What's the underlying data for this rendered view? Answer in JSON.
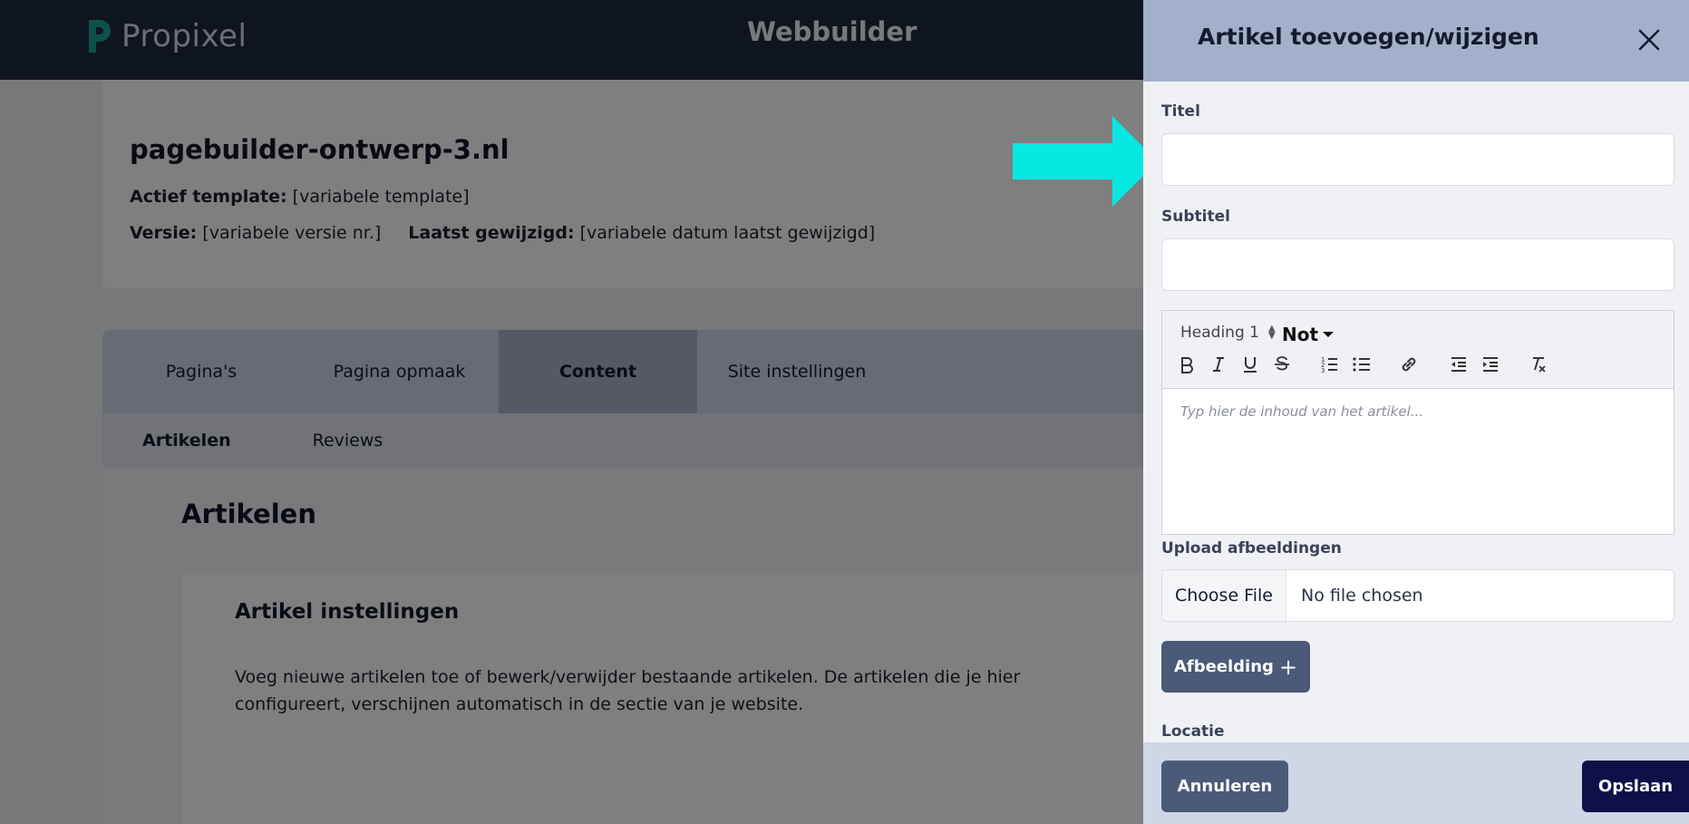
{
  "topbar": {
    "brand": "Propixel",
    "title": "Webbuilder",
    "brand_color": "#1ba394"
  },
  "site": {
    "name": "pagebuilder-ontwerp-3.nl",
    "template_label": "Actief template:",
    "template_value": "[variabele template]",
    "version_label": "Versie:",
    "version_value": "[variabele versie nr.]",
    "modified_label": "Laatst gewijzigd:",
    "modified_value": "[variabele datum laatst gewijzigd]"
  },
  "tabs": [
    {
      "label": "Pagina's"
    },
    {
      "label": "Pagina opmaak"
    },
    {
      "label": "Content"
    },
    {
      "label": "Site instellingen"
    }
  ],
  "active_tab": "Content",
  "subtabs": [
    {
      "label": "Artikelen"
    },
    {
      "label": "Reviews"
    }
  ],
  "content": {
    "title": "Artikelen",
    "settings_title": "Artikel instellingen",
    "settings_desc": "Voeg nieuwe artikelen toe of bewerk/verwijder bestaande artikelen. De artikelen die je hier configureert, verschijnen automatisch in de sectie van je website."
  },
  "panel": {
    "title": "Artikel toevoegen/wijzigen",
    "title_label": "Titel",
    "title_value": "",
    "subtitle_label": "Subtitel",
    "subtitle_value": "",
    "editor": {
      "heading": "Heading 1",
      "font": "Not",
      "placeholder": "Typ hier de inhoud van het artikel...",
      "tools": [
        "bold",
        "italic",
        "underline",
        "strikethrough",
        "ordered-list",
        "bullet-list",
        "link",
        "outdent",
        "indent",
        "clear-format"
      ]
    },
    "upload_label": "Upload afbeeldingen",
    "choose_file": "Choose File",
    "no_file": "No file chosen",
    "add_image": "Afbeelding",
    "location_label": "Locatie",
    "cancel": "Annuleren",
    "save": "Opslaan"
  },
  "annotation": {
    "arrow_color": "#08e8e3"
  }
}
